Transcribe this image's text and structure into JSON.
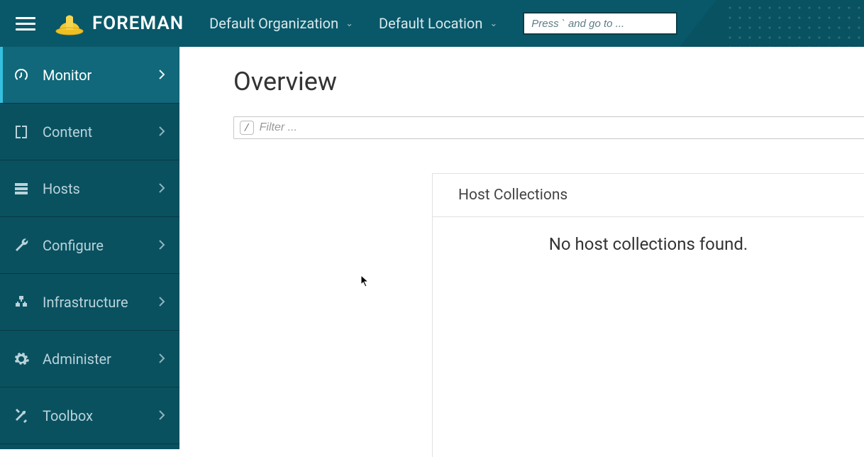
{
  "header": {
    "brand": "FOREMAN",
    "org_dropdown": "Default Organization",
    "loc_dropdown": "Default Location",
    "search_placeholder": "Press ` and go to ..."
  },
  "sidebar": {
    "items": [
      {
        "label": "Monitor",
        "icon": "dashboard-icon",
        "active": true
      },
      {
        "label": "Content",
        "icon": "book-icon",
        "active": false
      },
      {
        "label": "Hosts",
        "icon": "server-icon",
        "active": false
      },
      {
        "label": "Configure",
        "icon": "wrench-icon",
        "active": false
      },
      {
        "label": "Infrastructure",
        "icon": "sitemap-icon",
        "active": false
      },
      {
        "label": "Administer",
        "icon": "gear-icon",
        "active": false
      },
      {
        "label": "Toolbox",
        "icon": "tools-icon",
        "active": false
      }
    ]
  },
  "main": {
    "title": "Overview",
    "filter_key": "/",
    "filter_placeholder": "Filter ...",
    "card_title": "Host Collections",
    "card_empty": "No host collections found."
  }
}
